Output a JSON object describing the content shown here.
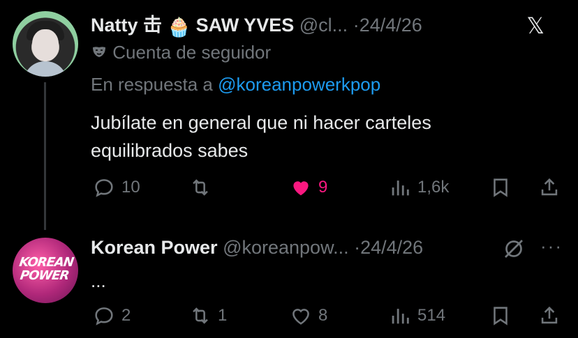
{
  "app": {
    "close_label": "𝕏"
  },
  "tweet1": {
    "name": "Natty 击",
    "name2": "SAW YVES",
    "handle": "@cl...",
    "sep": "·",
    "date": "24/4/26",
    "account_label": "Cuenta de seguidor",
    "reply_prefix": "En respuesta a",
    "reply_handle": "@koreanpowerkpop",
    "text": "Jubílate en general que ni hacer carteles equilibrados sabes",
    "replies": "10",
    "retweets": "",
    "likes": "9",
    "views": "1,6k"
  },
  "tweet2": {
    "name": "Korean Power",
    "handle": "@koreanpow...",
    "sep": "·",
    "date": "24/4/26",
    "text": "...",
    "avatar_logo_line1": "KOREAN",
    "avatar_logo_line2": "POWER",
    "replies": "2",
    "retweets": "1",
    "likes": "8",
    "views": "514",
    "more": "···"
  },
  "colors": {
    "accent": "#1d9bf0",
    "like": "#f91880",
    "muted": "#71767b",
    "text": "#e7e9ea"
  }
}
